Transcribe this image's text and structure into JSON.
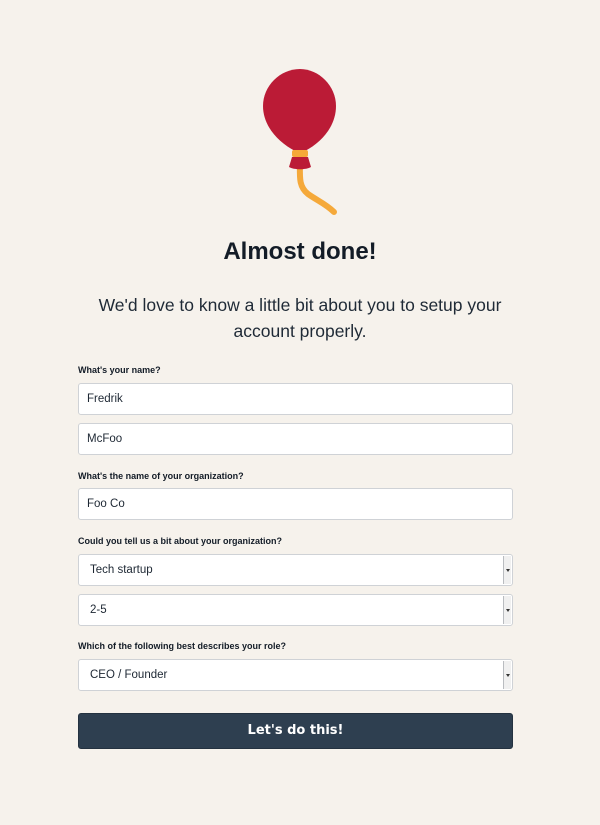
{
  "hero": {
    "icon": "balloon-icon",
    "title": "Almost done!",
    "subtitle": "We'd love to know a little bit about you to setup your account properly."
  },
  "form": {
    "name_label": "What's your name?",
    "first_name": "Fredrik",
    "last_name": "McFoo",
    "org_label": "What's the name of your organization?",
    "org_name": "Foo Co",
    "about_label": "Could you tell us a bit about your organization?",
    "org_type": "Tech startup",
    "org_size": "2-5",
    "role_label": "Which of the following best describes your role?",
    "role": "CEO / Founder",
    "submit_label": "Let's do this!"
  },
  "colors": {
    "background": "#f6f2ec",
    "balloon": "#bb1b36",
    "string": "#f5a93a",
    "button": "#2e3f50"
  }
}
